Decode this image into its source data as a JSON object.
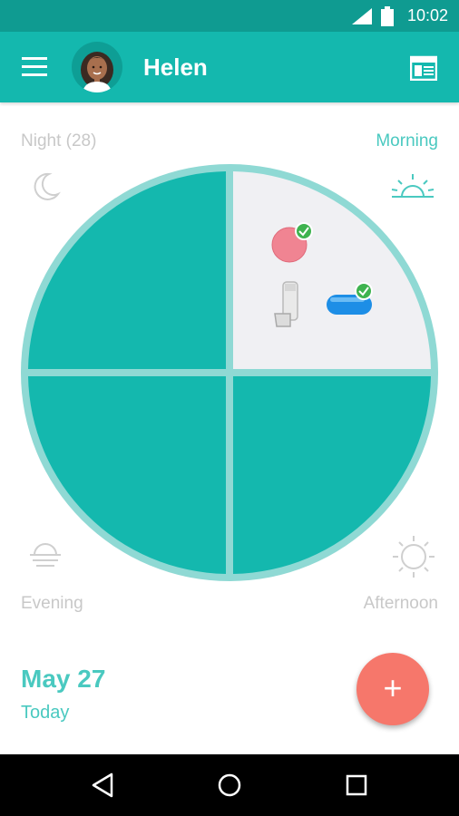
{
  "status_bar": {
    "time": "10:02"
  },
  "app_bar": {
    "user_name": "Helen"
  },
  "quadrants": {
    "night": {
      "label": "Night (28)"
    },
    "morning": {
      "label": "Morning"
    },
    "evening": {
      "label": "Evening"
    },
    "afternoon": {
      "label": "Afternoon"
    }
  },
  "medications": [
    {
      "name": "pink-pill",
      "taken": true
    },
    {
      "name": "inhaler",
      "taken": false
    },
    {
      "name": "blue-capsule",
      "taken": true
    }
  ],
  "date": {
    "title": "May 27",
    "subtitle": "Today"
  },
  "fab": {
    "label": "+"
  },
  "colors": {
    "primary": "#14b8ae",
    "status": "#0f9b91",
    "accent": "#4ac9c0",
    "fab": "#f6776b",
    "ring": "#8fd9d4"
  }
}
